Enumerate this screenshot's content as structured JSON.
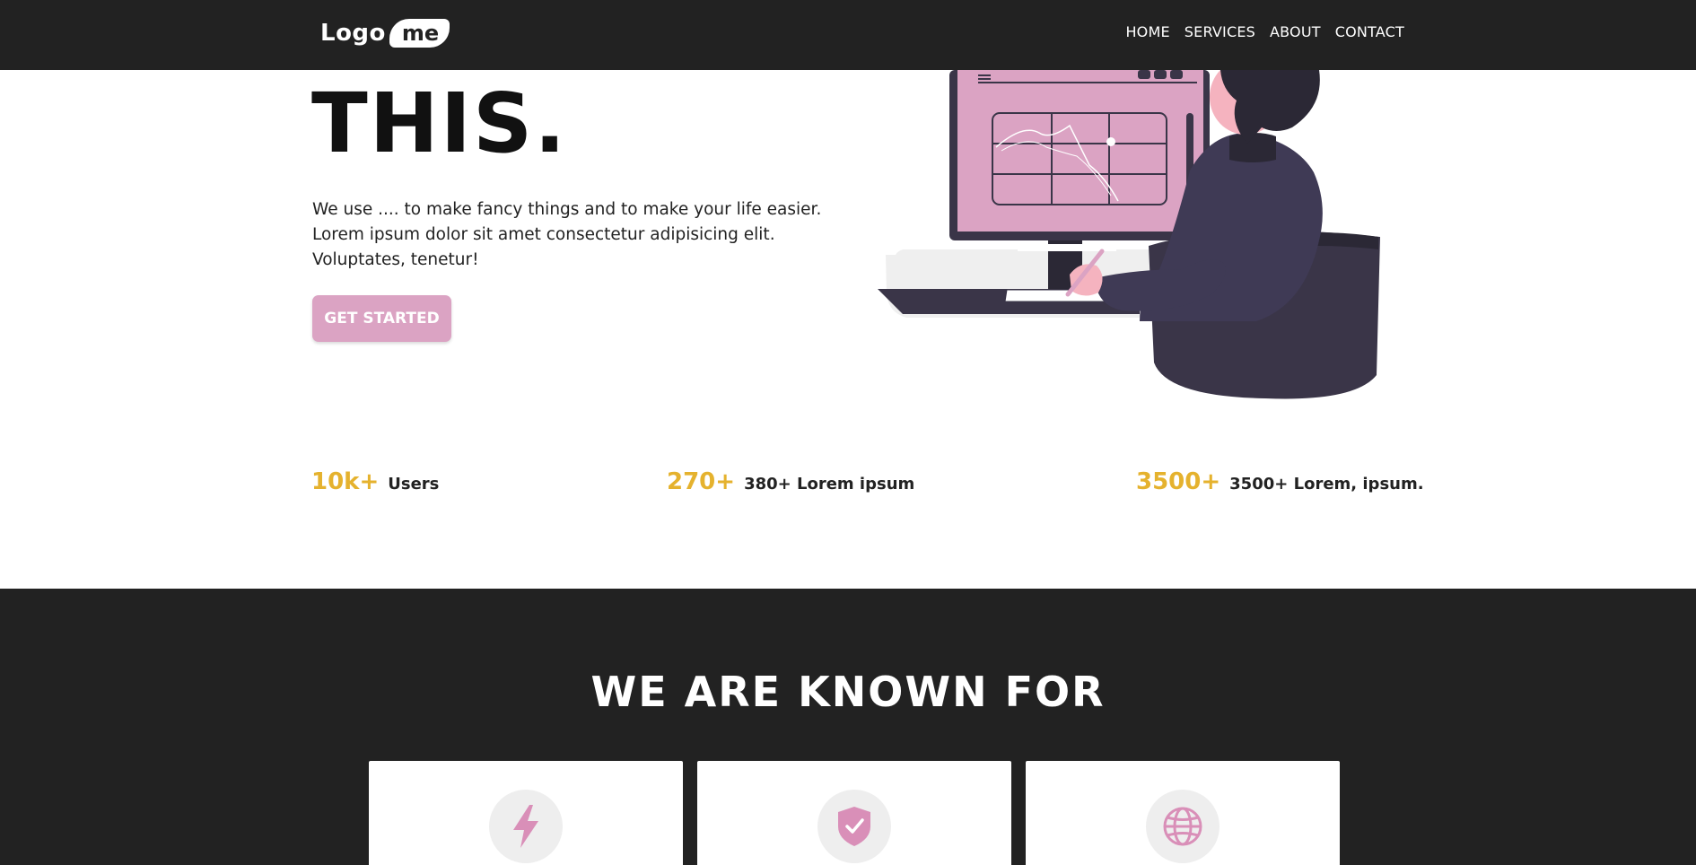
{
  "header": {
    "logo_text": "Logo",
    "logo_pill": "me",
    "nav": [
      "HOME",
      "SERVICES",
      "ABOUT",
      "CONTACT"
    ]
  },
  "hero": {
    "title": "THIS.",
    "text_lines": [
      "We use .... to make fancy things and to make your life easier.",
      "Lorem ipsum dolor sit amet consectetur adipisicing elit.",
      "Voluptates, tenetur!"
    ],
    "cta_label": "GET STARTED"
  },
  "stats": [
    {
      "value": "10k+",
      "label": "Users"
    },
    {
      "value": "270+",
      "label": "380+ Lorem ipsum"
    },
    {
      "value": "3500+",
      "label": "3500+ Lorem, ipsum."
    }
  ],
  "known_for": {
    "title": "WE ARE KNOWN FOR",
    "cards": [
      {
        "icon": "lightning-icon"
      },
      {
        "icon": "shield-check-icon"
      },
      {
        "icon": "globe-icon"
      }
    ]
  },
  "colors": {
    "dark": "#222222",
    "accent_pink": "#dba3c3",
    "stat_gold": "#e5b22e",
    "icon_pink": "#d98fb8"
  }
}
